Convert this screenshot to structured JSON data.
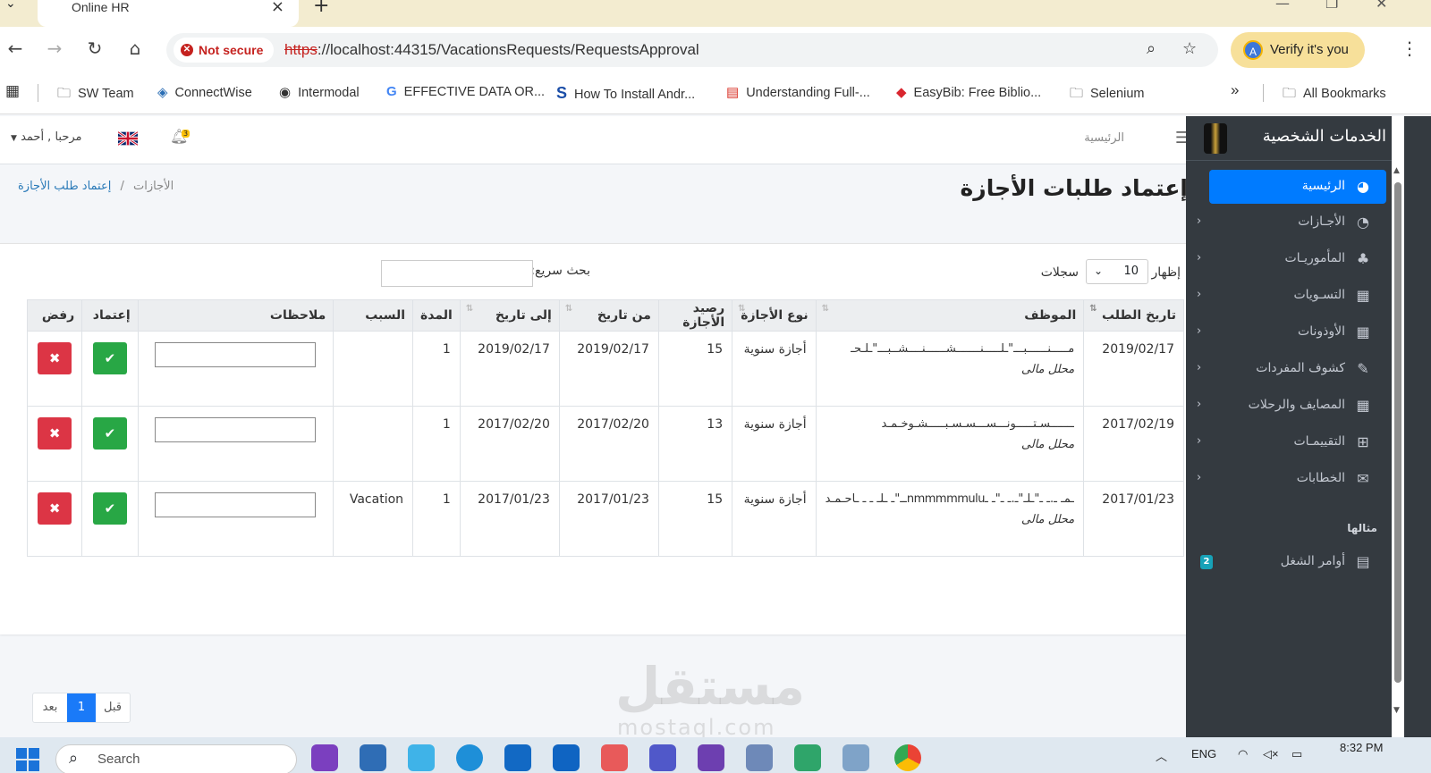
{
  "browser": {
    "tab_title": "Online HR",
    "not_secure": "Not secure",
    "url_scheme": "https",
    "url_rest": "://localhost:44315/VacationsRequests/RequestsApproval",
    "verify": "Verify it's you",
    "verify_avatar": "A",
    "bookmarks": [
      "SW Team",
      "ConnectWise",
      "Intermodal",
      "EFFECTIVE DATA OR...",
      "How To Install Andr...",
      "Understanding Full-...",
      "EasyBib: Free Biblio...",
      "Selenium"
    ],
    "all_bookmarks": "All Bookmarks"
  },
  "topnav": {
    "home": "الرئيسية",
    "user_greeting": "مرحبا , أحمد",
    "bell_count": "3"
  },
  "page": {
    "title": "إعتماد طلبات الأجازة",
    "breadcrumb_parent": "الأجازات",
    "breadcrumb_sep": "/",
    "breadcrumb_current": "إعتماد طلب الأجازة"
  },
  "table_controls": {
    "show": "إظهار",
    "page_length": "10",
    "records": "سجلات",
    "search": "بحث سريع:"
  },
  "table": {
    "headers": {
      "request_date": "تاريخ الطلب",
      "employee": "الموظف",
      "leave_type": "نوع الأجازة",
      "balance": "رصيد الأجازة",
      "from": "من تاريخ",
      "to": "إلى تاريخ",
      "duration": "المدة",
      "reason": "السبب",
      "notes": "ملاحظات",
      "approve": "إعتماد",
      "reject": "رفض"
    },
    "rows": [
      {
        "request_date": "2019/02/17",
        "employee": "مـــــنــــــبـــ\"ـلـــــنـــــــشــــــنــــشــبـــ\"ـلـحـ",
        "department": "محلل مالى",
        "leave_type": "أجازة سنوية",
        "balance": "15",
        "from": "2019/02/17",
        "to": "2019/02/17",
        "duration": "1",
        "reason": ""
      },
      {
        "request_date": "2017/02/19",
        "employee": "ـــــــسـتـــــونـــســـسـسـبـــــشـوخـمـد",
        "department": "محلل مالى",
        "leave_type": "أجازة سنوية",
        "balance": "13",
        "from": "2017/02/20",
        "to": "2017/02/20",
        "duration": "1",
        "reason": ""
      },
      {
        "request_date": "2017/01/23",
        "employee": "ـمـ ـ.ـ ـ\"ـلـ\"ـ.ـ ـ\"ـ ـnmmmmmuluــ\"ـ ـلـ ـ ـ ـاحـمـد",
        "department": "محلل مالى",
        "leave_type": "أجازة سنوية",
        "balance": "15",
        "from": "2017/01/23",
        "to": "2017/01/23",
        "duration": "1",
        "reason": "Vacation"
      }
    ]
  },
  "pagination": {
    "prev": "قبل",
    "current": "1",
    "next": "بعد"
  },
  "sidebar": {
    "brand": "الخدمات الشخصية",
    "items": [
      {
        "label": "الرئيسية",
        "icon": "dashboard-icon"
      },
      {
        "label": "الأجـازات",
        "icon": "pie-chart-icon"
      },
      {
        "label": "المأموريـات",
        "icon": "tree-icon"
      },
      {
        "label": "التسـويات",
        "icon": "table-icon"
      },
      {
        "label": "الأوذونات",
        "icon": "table-icon"
      },
      {
        "label": "كشوف المفردات",
        "icon": "edit-icon"
      },
      {
        "label": "المصايف والرحلات",
        "icon": "table-icon"
      },
      {
        "label": "التقييمـات",
        "icon": "plus-square-icon"
      },
      {
        "label": "الخطابات",
        "icon": "envelope-icon"
      }
    ],
    "section_header": "مثالها",
    "work_orders": "أوامر الشغل",
    "work_orders_badge": "2"
  },
  "watermark": {
    "ar": "مستقل",
    "en": "mostaql.com"
  },
  "taskbar": {
    "search": "Search",
    "lang": "ENG",
    "time": "8:32 PM"
  },
  "colors": {
    "primary": "#007bff",
    "approve": "#28a745",
    "reject": "#dc3545",
    "sidebar_bg": "#343a40"
  }
}
